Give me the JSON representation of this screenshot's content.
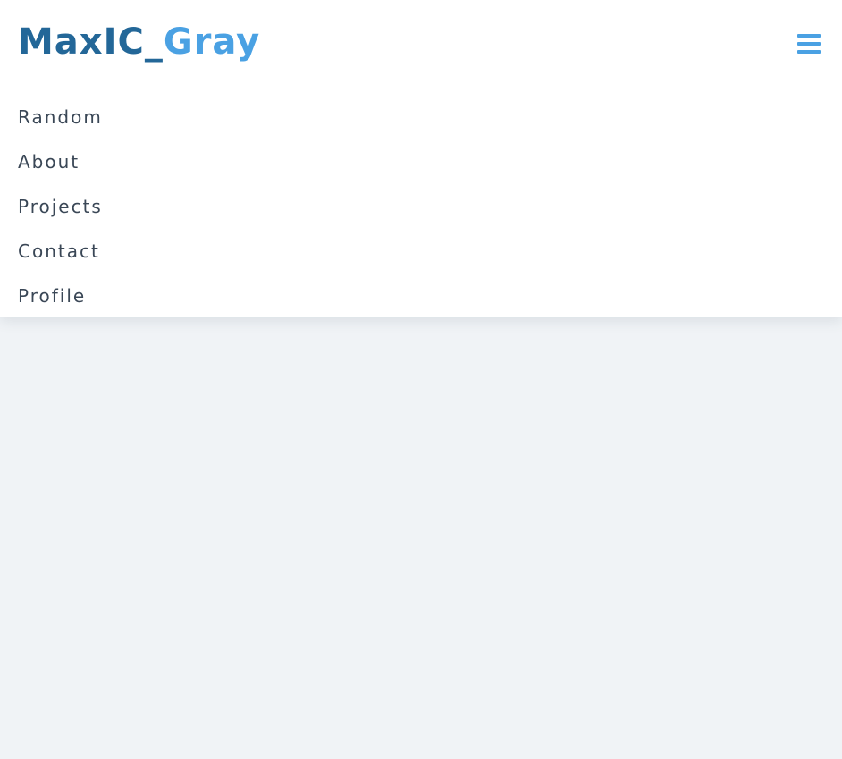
{
  "brand": {
    "part1": "MaxIC_",
    "part2": "Gray",
    "color1": "#236798",
    "color2": "#4aa1e3"
  },
  "menu_button": {
    "icon": "hamburger-menu-icon",
    "color": "#4aa1e3"
  },
  "nav": {
    "items": [
      {
        "label": "Random"
      },
      {
        "label": "About"
      },
      {
        "label": "Projects"
      },
      {
        "label": "Contact"
      },
      {
        "label": "Profile"
      }
    ]
  },
  "colors": {
    "background": "#f0f3f6",
    "header": "#ffffff",
    "nav_text": "#3a4756"
  }
}
